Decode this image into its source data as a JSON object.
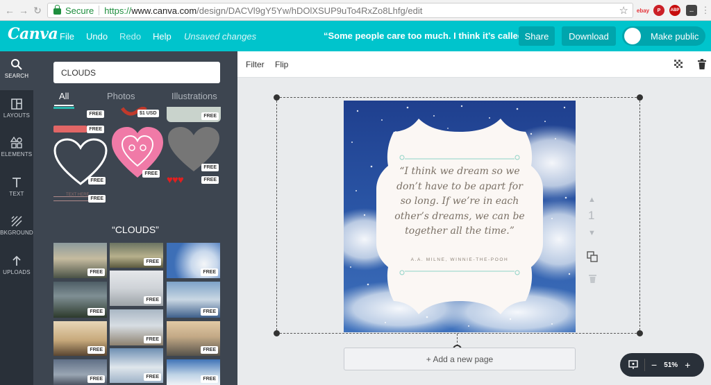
{
  "browser": {
    "secure_label": "Secure",
    "url_protocol": "https://",
    "url_host": "www.canva.com",
    "url_path": "/design/DACVl9gY5Yw/hDOlXSUP9uTo4RxZo8Lhfg/edit",
    "extensions": [
      "ebay",
      "P",
      "ABP",
      "..."
    ]
  },
  "header": {
    "logo": "Canva",
    "menu": {
      "file": "File",
      "undo": "Undo",
      "redo": "Redo",
      "help": "Help"
    },
    "unsaved": "Unsaved changes",
    "doc_title": "“Some people care too much. I think it’s called…",
    "share": "Share",
    "download": "Download",
    "make_public": "Make public",
    "accent_color": "#00c4cc"
  },
  "leftnav": [
    {
      "label": "SEARCH",
      "icon": "search-icon"
    },
    {
      "label": "LAYOUTS",
      "icon": "layouts-icon"
    },
    {
      "label": "ELEMENTS",
      "icon": "elements-icon"
    },
    {
      "label": "TEXT",
      "icon": "text-icon"
    },
    {
      "label": "BKGROUND",
      "icon": "background-icon"
    },
    {
      "label": "UPLOADS",
      "icon": "uploads-icon"
    }
  ],
  "panel": {
    "search_value": "CLOUDS",
    "tabs": {
      "all": "All",
      "photos": "Photos",
      "illustrations": "Illustrations"
    },
    "free_badge": "FREE",
    "price_badge": "$1 USD",
    "text_here": "TEXT HERE",
    "clouds_heading": "“CLOUDS”"
  },
  "toolbar": {
    "filter": "Filter",
    "flip": "Flip"
  },
  "design": {
    "quote": "“I think we dream so we don’t have to be apart for so long. If we’re in each other’s dreams, we can be together all the time.”",
    "attribution": "A.A. MILNE, WINNIE-THE-POOH"
  },
  "page": {
    "number": "1",
    "add_page": "+ Add a new page"
  },
  "zoom": {
    "level": "51%",
    "minus": "−",
    "plus": "+"
  }
}
